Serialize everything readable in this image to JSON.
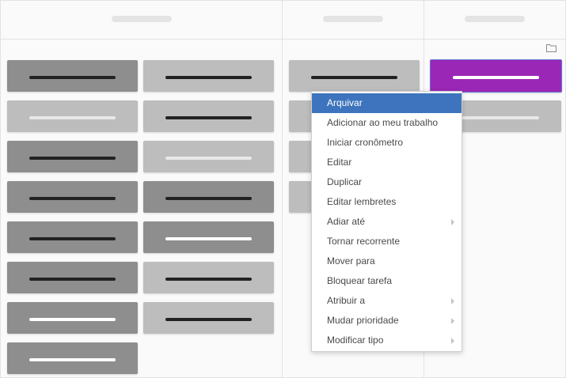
{
  "icons": {
    "folder": "folder-icon",
    "submenu_arrow": "chevron-right-icon"
  },
  "colors": {
    "selected_card": "#9a27b5",
    "menu_highlight": "#3d74bd",
    "card_dark": "#8e8e8e",
    "card_light": "#bdbdbd"
  },
  "context_menu": {
    "items": [
      {
        "label": "Arquivar",
        "active": true,
        "submenu": false
      },
      {
        "label": "Adicionar ao meu trabalho",
        "active": false,
        "submenu": false
      },
      {
        "label": "Iniciar cronômetro",
        "active": false,
        "submenu": false
      },
      {
        "label": "Editar",
        "active": false,
        "submenu": false
      },
      {
        "label": "Duplicar",
        "active": false,
        "submenu": false
      },
      {
        "label": "Editar lembretes",
        "active": false,
        "submenu": false
      },
      {
        "label": "Adiar até",
        "active": false,
        "submenu": true
      },
      {
        "label": "Tornar recorrente",
        "active": false,
        "submenu": false
      },
      {
        "label": "Mover para",
        "active": false,
        "submenu": false
      },
      {
        "label": "Bloquear tarefa",
        "active": false,
        "submenu": false
      },
      {
        "label": "Atribuir a",
        "active": false,
        "submenu": true
      },
      {
        "label": "Mudar prioridade",
        "active": false,
        "submenu": true
      },
      {
        "label": "Modificar tipo",
        "active": false,
        "submenu": true
      }
    ]
  }
}
